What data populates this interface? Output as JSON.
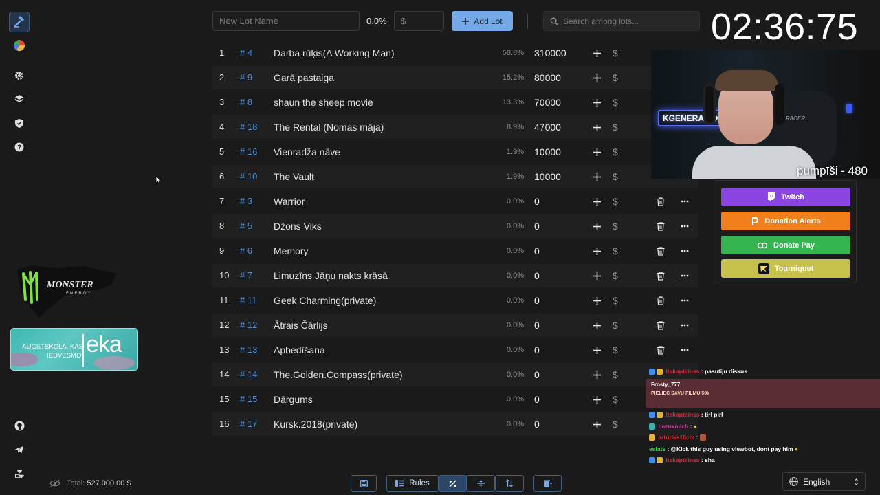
{
  "rail": {
    "icons": [
      "hammer-icon",
      "pie-chart-icon",
      "settings-icon",
      "layers-icon",
      "shield-icon",
      "help-icon",
      "github-icon",
      "telegram-icon",
      "donate-hand-icon"
    ]
  },
  "sponsors": {
    "monster_text": "MONSTER",
    "monster_sub": "ENERGY",
    "eka_text1": "AUGSTSKOLA, KAS",
    "eka_text2": "IEDVESMO!",
    "eka_logo": "eka"
  },
  "topbar": {
    "lot_name_placeholder": "New Lot Name",
    "percent": "0.0%",
    "amount_placeholder": "$",
    "add_lot_label": "Add Lot",
    "search_placeholder": "Search among lots..."
  },
  "timer": "02:36:75",
  "lots": [
    {
      "n": "1",
      "id": "# 4",
      "name": "Darba rūķis(A Working Man)",
      "pct": "58.8%",
      "amount": "310000"
    },
    {
      "n": "2",
      "id": "# 9",
      "name": "Garā pastaiga",
      "pct": "15.2%",
      "amount": "80000"
    },
    {
      "n": "3",
      "id": "# 8",
      "name": "shaun the sheep movie",
      "pct": "13.3%",
      "amount": "70000"
    },
    {
      "n": "4",
      "id": "# 18",
      "name": "The Rental (Nomas māja)",
      "pct": "8.9%",
      "amount": "47000"
    },
    {
      "n": "5",
      "id": "# 16",
      "name": "Vienradža nāve",
      "pct": "1.9%",
      "amount": "10000"
    },
    {
      "n": "6",
      "id": "# 10",
      "name": "The Vault",
      "pct": "1.9%",
      "amount": "10000"
    },
    {
      "n": "7",
      "id": "# 3",
      "name": "Warrior",
      "pct": "0.0%",
      "amount": "0"
    },
    {
      "n": "8",
      "id": "# 5",
      "name": "Džons Viks",
      "pct": "0.0%",
      "amount": "0"
    },
    {
      "n": "9",
      "id": "# 6",
      "name": "Memory",
      "pct": "0.0%",
      "amount": "0"
    },
    {
      "n": "10",
      "id": "# 7",
      "name": "Limuzīns Jāņu nakts krāsā",
      "pct": "0.0%",
      "amount": "0"
    },
    {
      "n": "11",
      "id": "# 11",
      "name": "Geek Charming(private)",
      "pct": "0.0%",
      "amount": "0"
    },
    {
      "n": "12",
      "id": "# 12",
      "name": "Ātrais Čārlijs",
      "pct": "0.0%",
      "amount": "0"
    },
    {
      "n": "13",
      "id": "# 13",
      "name": "Apbedīšana",
      "pct": "0.0%",
      "amount": "0"
    },
    {
      "n": "14",
      "id": "# 14",
      "name": "The.Golden.Compass(private)",
      "pct": "0.0%",
      "amount": "0"
    },
    {
      "n": "15",
      "id": "# 15",
      "name": "Dārgums",
      "pct": "0.0%",
      "amount": "0"
    },
    {
      "n": "16",
      "id": "# 17",
      "name": "Kursk.2018(private)",
      "pct": "0.0%",
      "amount": "0"
    }
  ],
  "webcam": {
    "caption": "pumpīši - 480",
    "neon_sign": "KGENERALEX",
    "chair_text": "RACER"
  },
  "donations": {
    "buttons": [
      {
        "label": "Twitch",
        "color": "#8b45e0"
      },
      {
        "label": "Donation Alerts",
        "color": "#f07f1c"
      },
      {
        "label": "Donate Pay",
        "color": "#35b54f"
      },
      {
        "label": "Tourniquet",
        "color": "#c7c04a"
      }
    ]
  },
  "chat": {
    "messages": [
      {
        "user": "itskapteinss",
        "text": ": pasutiju diskus",
        "color": "#e0273b"
      },
      {
        "user": "Frosty_777",
        "text": "PIELIEC SAVU FILMU 50k",
        "color": "#ffffff"
      },
      {
        "user": "itskapteinss",
        "text": ": tirl pirl",
        "color": "#e0273b"
      },
      {
        "user": "bezuxmich",
        "text": ":",
        "color": "#c43a9a"
      },
      {
        "user": "arturiks19cm",
        "text": ":",
        "color": "#e0273b"
      },
      {
        "user": "eslats",
        "text": ": @Kick this guy using viewbot, dont pay him",
        "color": "#3cdc52"
      },
      {
        "user": "itskapteinss",
        "text": ": sha",
        "color": "#e0273b"
      }
    ]
  },
  "footer": {
    "total_label": "Total:",
    "total_value": "527.000,00 $",
    "rules_label": "Rules",
    "language": "English"
  }
}
